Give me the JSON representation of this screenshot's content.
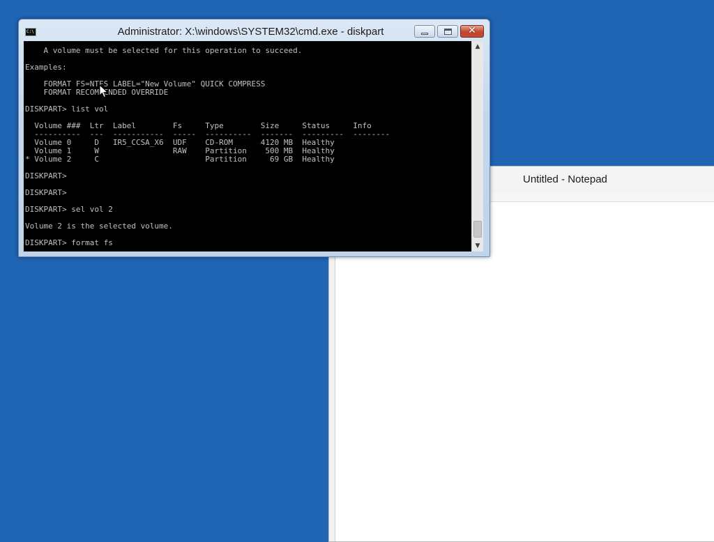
{
  "notepad": {
    "title": "Untitled - Notepad"
  },
  "cmd": {
    "title": "Administrator: X:\\windows\\SYSTEM32\\cmd.exe - diskpart",
    "icon": "C:\\",
    "lines": [
      "    A volume must be selected for this operation to succeed.",
      "",
      "Examples:",
      "",
      "    FORMAT FS=NTFS LABEL=\"New Volume\" QUICK COMPRESS",
      "    FORMAT RECOMMENDED OVERRIDE",
      "",
      "DISKPART> list vol",
      "",
      "  Volume ###  Ltr  Label        Fs     Type        Size     Status     Info",
      "  ----------  ---  -----------  -----  ----------  -------  ---------  --------",
      "  Volume 0     D   IR5_CCSA_X6  UDF    CD-ROM      4120 MB  Healthy",
      "  Volume 1     W                RAW    Partition    500 MB  Healthy",
      "* Volume 2     C                       Partition     69 GB  Healthy",
      "",
      "DISKPART>",
      "",
      "DISKPART>",
      "",
      "DISKPART> sel vol 2",
      "",
      "Volume 2 is the selected volume.",
      "",
      "DISKPART> format fs"
    ],
    "buttons": {
      "minimize": "minimize",
      "maximize": "maximize",
      "close": "✕"
    },
    "scrollbar": {
      "up": "▲",
      "down": "▼"
    }
  },
  "colors": {
    "desktop": "#2064b4",
    "console_bg": "#000000",
    "console_fg": "#c0c0c0",
    "close_button": "#c0472e"
  }
}
